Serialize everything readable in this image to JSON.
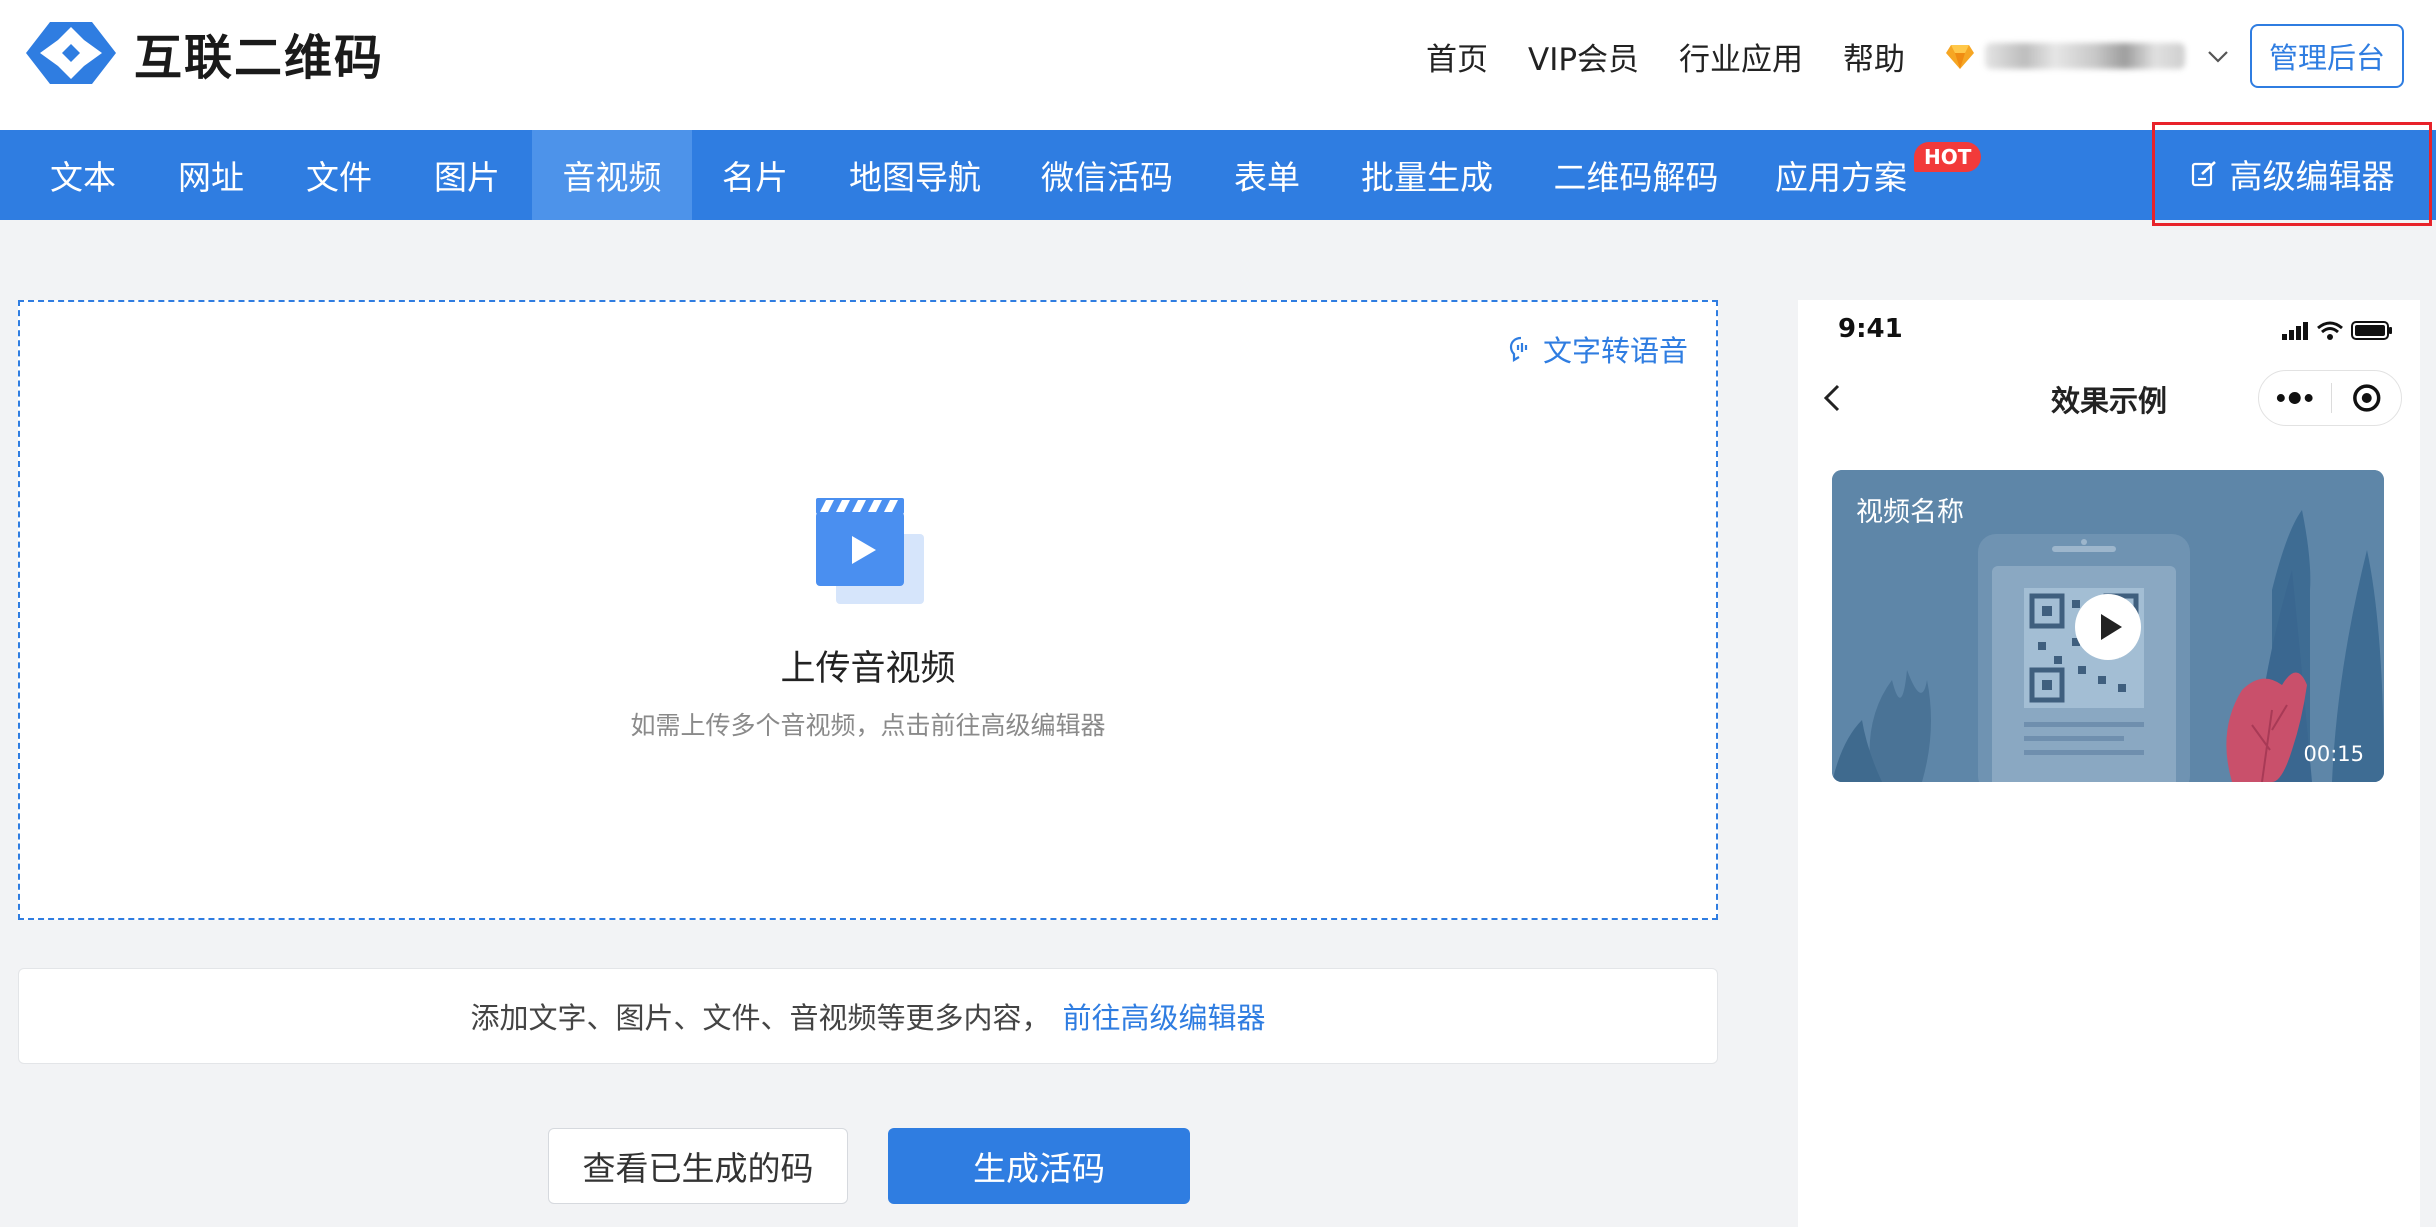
{
  "header": {
    "logo_text": "互联二维码",
    "nav": [
      "首页",
      "VIP会员",
      "行业应用",
      "帮助"
    ],
    "admin_button": "管理后台"
  },
  "categories": {
    "items": [
      "文本",
      "网址",
      "文件",
      "图片",
      "音视频",
      "名片",
      "地图导航",
      "微信活码",
      "表单",
      "批量生成",
      "二维码解码",
      "应用方案"
    ],
    "active": "音视频",
    "hot_badge": "HOT",
    "advanced_editor": "高级编辑器"
  },
  "upload": {
    "tts_link": "文字转语音",
    "title": "上传音视频",
    "hint": "如需上传多个音视频，点击前往高级编辑器"
  },
  "more": {
    "text": "添加文字、图片、文件、音视频等更多内容，",
    "link": "前往高级编辑器"
  },
  "buttons": {
    "view_generated": "查看已生成的码",
    "generate": "生成活码"
  },
  "preview": {
    "time": "9:41",
    "title": "效果示例",
    "video_name": "视频名称",
    "duration": "00:15"
  },
  "colors": {
    "primary": "#2f7de1",
    "nav_active": "#4d93ea",
    "hot": "#f23a3a",
    "highlight_box": "#e8222a"
  }
}
